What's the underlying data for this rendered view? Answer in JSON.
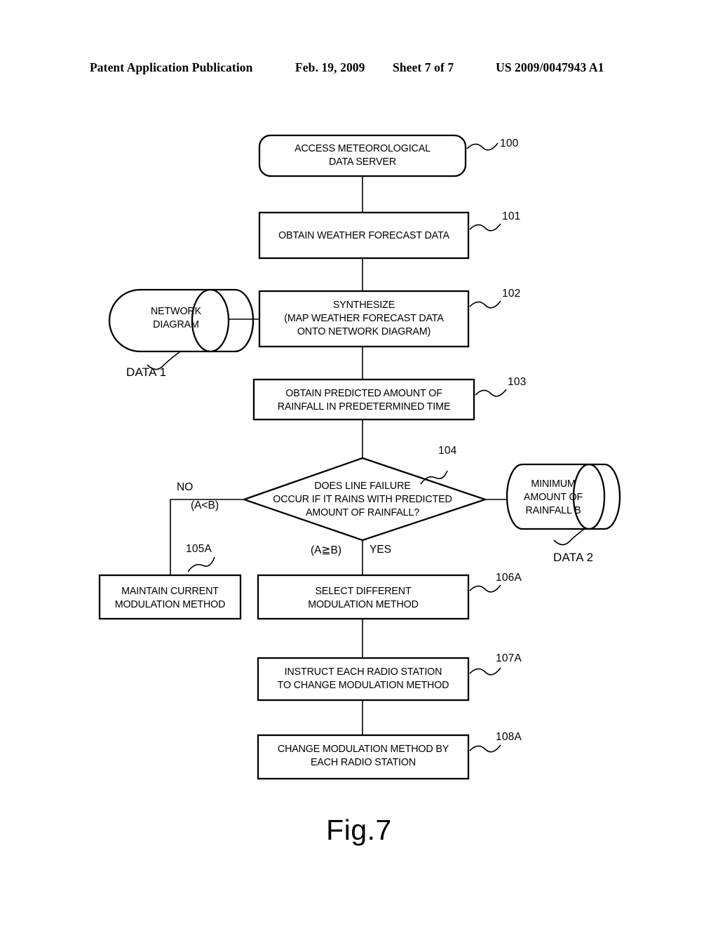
{
  "header": {
    "publication": "Patent Application Publication",
    "date": "Feb. 19, 2009",
    "sheet": "Sheet 7 of 7",
    "patent_number": "US 2009/0047943 A1"
  },
  "figure": {
    "caption": "Fig.7",
    "line_color": "#000000",
    "fill_color": "#ffffff"
  },
  "nodes": {
    "n100": {
      "ref": "100",
      "text": "ACCESS METEOROLOGICAL\nDATA SERVER",
      "shape": "rounded-rectangle"
    },
    "n101": {
      "ref": "101",
      "text": "OBTAIN WEATHER FORECAST DATA",
      "shape": "rectangle"
    },
    "n102": {
      "ref": "102",
      "text": "SYNTHESIZE\n(MAP WEATHER FORECAST DATA\nONTO NETWORK DIAGRAM)",
      "shape": "rectangle"
    },
    "n103": {
      "ref": "103",
      "text": "OBTAIN PREDICTED AMOUNT OF\nRAINFALL IN PREDETERMINED TIME",
      "shape": "rectangle"
    },
    "n104": {
      "ref": "104",
      "text": "DOES LINE FAILURE\nOCCUR IF IT RAINS WITH PREDICTED\nAMOUNT OF RAINFALL?",
      "shape": "diamond"
    },
    "n105A": {
      "ref": "105A",
      "text": "MAINTAIN CURRENT\nMODULATION METHOD",
      "shape": "rectangle"
    },
    "n106A": {
      "ref": "106A",
      "text": "SELECT DIFFERENT\nMODULATION METHOD",
      "shape": "rectangle"
    },
    "n107A": {
      "ref": "107A",
      "text": "INSTRUCT EACH RADIO STATION\nTO CHANGE MODULATION METHOD",
      "shape": "rectangle"
    },
    "n108A": {
      "ref": "108A",
      "text": "CHANGE MODULATION METHOD BY\nEACH RADIO STATION",
      "shape": "rectangle"
    },
    "data1": {
      "ref": "DATA 1",
      "text": "NETWORK\nDIAGRAM",
      "shape": "cylinder"
    },
    "data2": {
      "ref": "DATA 2",
      "text": "MINIMUM\nAMOUNT OF\nRAINFALL B",
      "shape": "cylinder"
    }
  },
  "branches": {
    "no_label": "NO",
    "no_condition": "(A<B)",
    "yes_label": "YES",
    "yes_condition": "(A≧B)"
  }
}
